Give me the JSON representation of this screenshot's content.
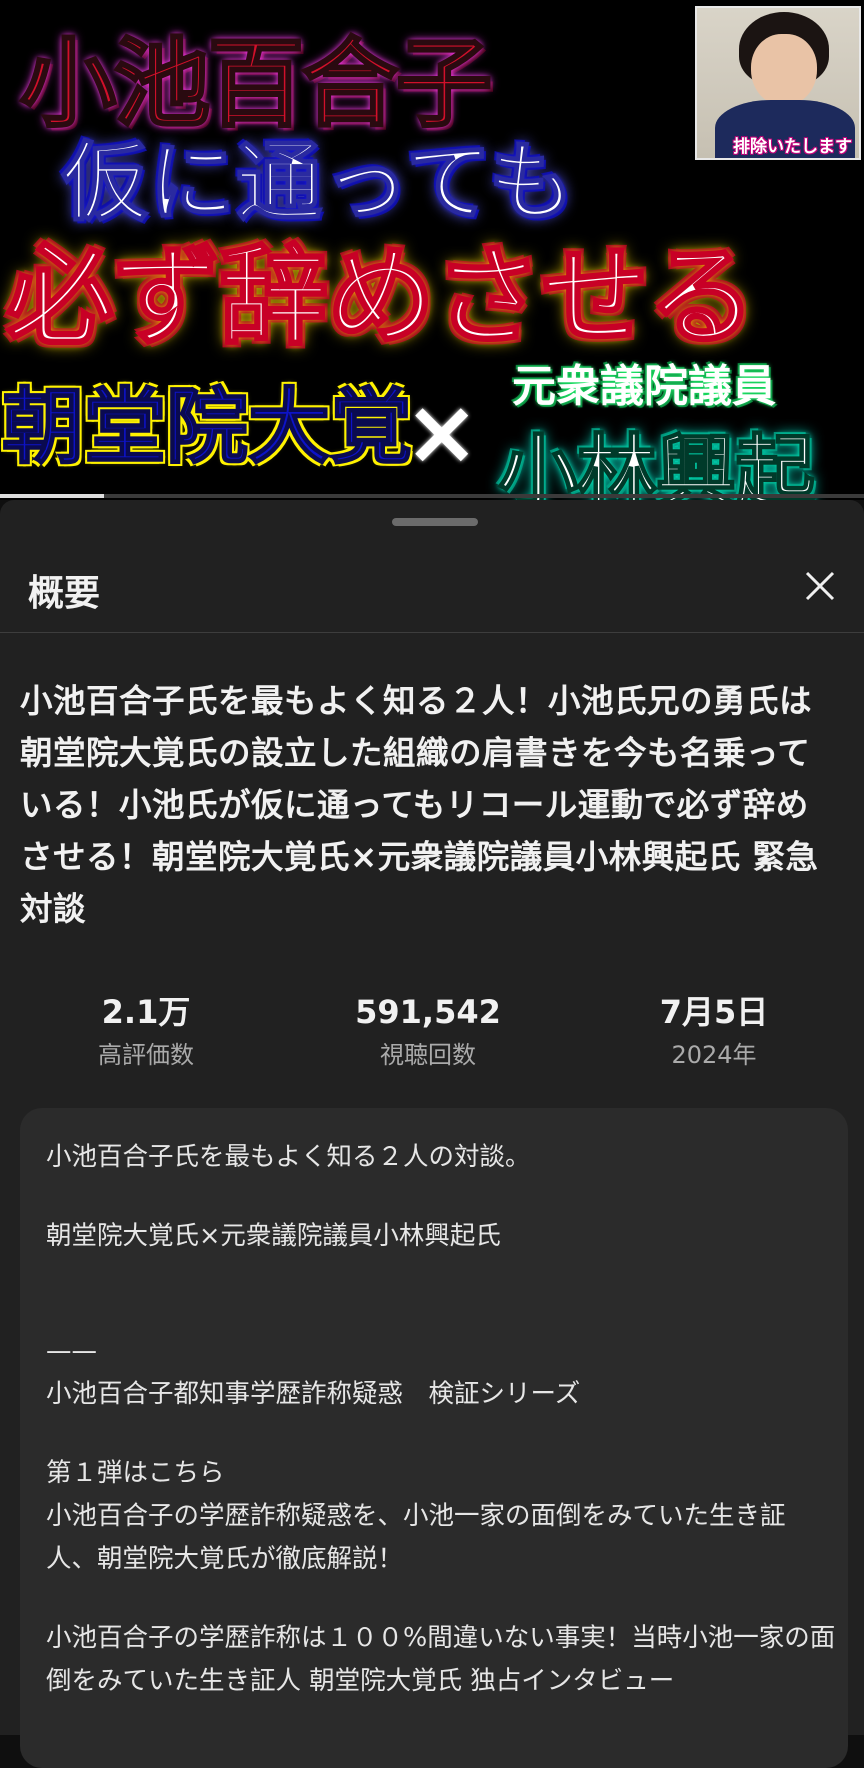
{
  "thumbnail": {
    "line1": "小池百合子",
    "line2": "仮に通っても",
    "line3": "必ず辞めさせる",
    "line4": "朝堂院大覚",
    "cross": "×",
    "line5": "元衆議院議員",
    "line6": "小林興起",
    "photo_caption": "排除いたします"
  },
  "sheet": {
    "title": "概要",
    "close_icon": "close-icon",
    "video_title": "小池百合子氏を最もよく知る２人！小池氏兄の勇氏は朝堂院大覚氏の設立した組織の肩書きを今も名乗っている！小池氏が仮に通ってもリコール運動で必ず辞めさせる！朝堂院大覚氏×元衆議院議員小林興起氏 緊急対談",
    "stats": {
      "likes_value": "2.1万",
      "likes_label": "高評価数",
      "views_value": "591,542",
      "views_label": "視聴回数",
      "date_value": "7月5日",
      "date_label": "2024年"
    },
    "description": {
      "p1": "小池百合子氏を最もよく知る２人の対談。",
      "p2": "朝堂院大覚氏×元衆議院議員小林興起氏",
      "sep": "——",
      "p3": "小池百合子都知事学歴詐称疑惑　検証シリーズ",
      "p4a": "第１弾はこちら",
      "p4b": "小池百合子の学歴詐称疑惑を、小池一家の面倒をみていた生き証人、朝堂院大覚氏が徹底解説！",
      "p5": "小池百合子の学歴詐称は１００%間違いない事実！当時小池一家の面倒をみていた生き証人 朝堂院大覚氏 独占インタビュー"
    }
  },
  "colors": {
    "background": "#0f0f0f",
    "sheet": "#212121",
    "description_box": "#2b2b2b",
    "secondary_text": "#aaaaaa"
  },
  "video_progress": 0.12
}
